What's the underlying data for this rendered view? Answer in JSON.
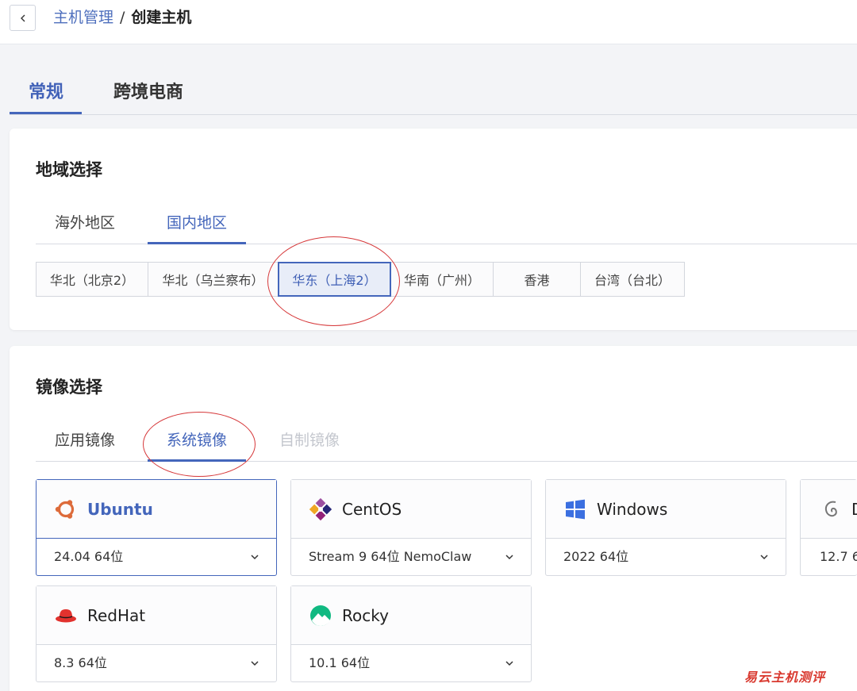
{
  "breadcrumb": {
    "parent": "主机管理",
    "separator": "/",
    "current": "创建主机"
  },
  "main_tabs": [
    {
      "label": "常规"
    },
    {
      "label": "跨境电商"
    }
  ],
  "region": {
    "title": "地域选择",
    "tabs": [
      {
        "label": "海外地区"
      },
      {
        "label": "国内地区"
      }
    ],
    "options": [
      {
        "label": "华北（北京2）"
      },
      {
        "label": "华北（乌兰察布）"
      },
      {
        "label": "华东（上海2）"
      },
      {
        "label": "华南（广州）"
      },
      {
        "label": "香港"
      },
      {
        "label": "台湾（台北）"
      }
    ],
    "selected": "华东（上海2）"
  },
  "image": {
    "title": "镜像选择",
    "tabs": [
      {
        "label": "应用镜像"
      },
      {
        "label": "系统镜像"
      },
      {
        "label": "自制镜像"
      }
    ],
    "os": [
      {
        "name": "Ubuntu",
        "version": "24.04 64位",
        "icon": "ubuntu-icon"
      },
      {
        "name": "CentOS",
        "version": "Stream 9 64位 NemoClaw",
        "icon": "centos-icon"
      },
      {
        "name": "Windows",
        "version": "2022 64位",
        "icon": "windows-icon"
      },
      {
        "name": "D",
        "version": "12.7 6",
        "icon": "debian-icon"
      },
      {
        "name": "RedHat",
        "version": "8.3 64位",
        "icon": "redhat-icon"
      },
      {
        "name": "Rocky",
        "version": "10.1 64位",
        "icon": "rocky-icon"
      }
    ]
  },
  "watermark": "易云主机测评",
  "colors": {
    "accent": "#4466bb",
    "annotation": "#d6383a"
  }
}
